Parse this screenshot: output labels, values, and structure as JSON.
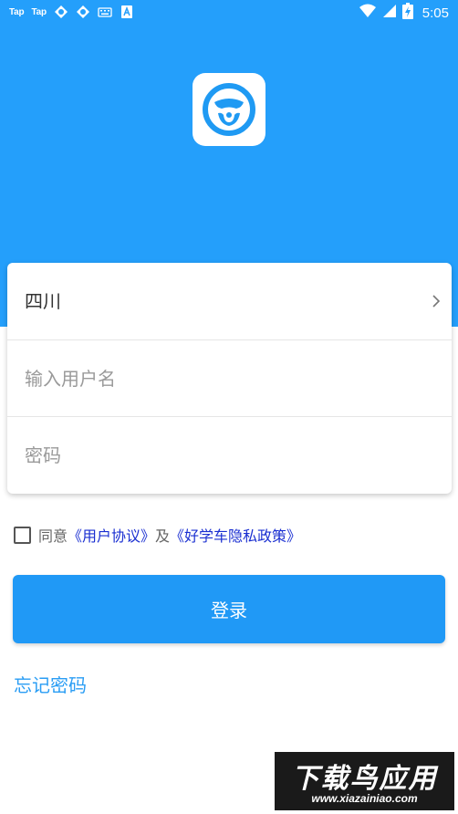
{
  "status_bar": {
    "left_labels": [
      "Tap",
      "Tap"
    ],
    "time": "5:05",
    "icons": [
      "taptap-icon",
      "taptap-icon",
      "loop-icon",
      "loop-icon",
      "keyboard-icon",
      "a-icon",
      "wifi-icon",
      "signal-icon",
      "battery-charging-icon"
    ]
  },
  "colors": {
    "header_bg": "#249ffb",
    "primary": "#2099f6",
    "link": "#1a2fd1"
  },
  "form": {
    "region": "四川",
    "username_placeholder": "输入用户名",
    "password_placeholder": "密码"
  },
  "agreement": {
    "prefix": "同意",
    "user_agreement": "《用户协议》",
    "and": "及",
    "privacy_policy": "《好学车隐私政策》"
  },
  "login_label": "登录",
  "forgot_label": "忘记密码",
  "watermark": {
    "title": "下载鸟应用",
    "url": "www.xiazainiao.com"
  }
}
